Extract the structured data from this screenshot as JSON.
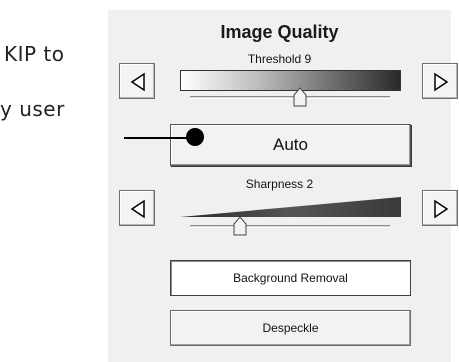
{
  "document": {
    "line1": "KIP to",
    "line2": "y   user"
  },
  "panel": {
    "title": "Image Quality",
    "threshold_label": "Threshold 9",
    "threshold_level": 0.55,
    "auto_label": "Auto",
    "sharpness_label": "Sharpness 2",
    "sharpness_level": 0.25,
    "background_removal_label": "Background Removal",
    "background_removal_pressed": true,
    "despeckle_label": "Despeckle",
    "despeckle_pressed": false
  },
  "icons": {
    "threshold_decrease": "triangle-left-icon",
    "threshold_increase": "triangle-right-icon",
    "sharpness_decrease": "triangle-left-icon",
    "sharpness_increase": "triangle-right-icon"
  },
  "colors": {
    "panel_background": "#f0f0f0",
    "callout": "#000000"
  }
}
